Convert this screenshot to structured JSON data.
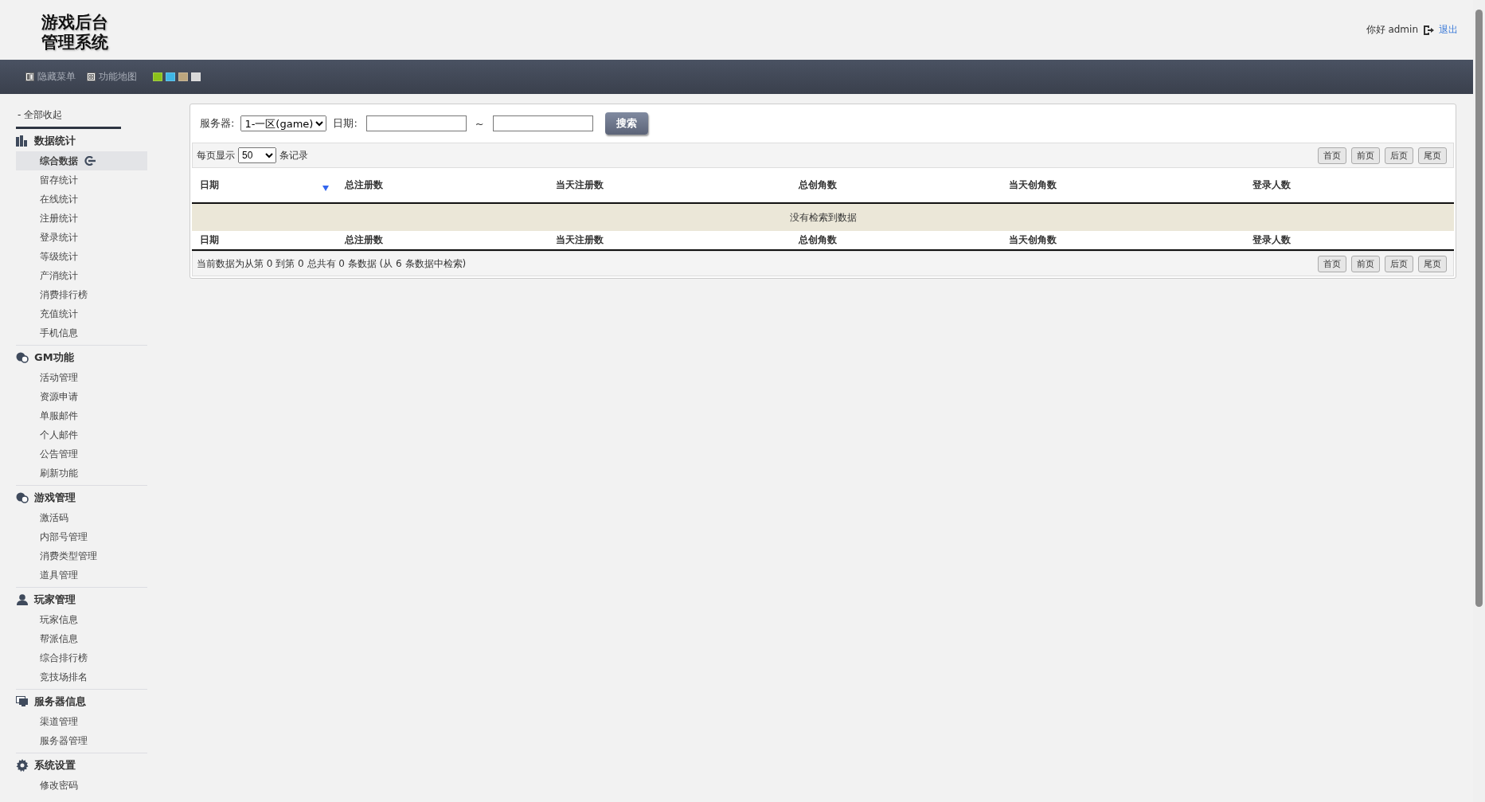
{
  "logo": {
    "lines": [
      "游戏后台",
      "管理系统"
    ]
  },
  "user": {
    "greeting": "你好 admin",
    "logout": "退出"
  },
  "toolbar": {
    "items": [
      {
        "label": "隐藏菜单",
        "kind": "columns"
      },
      {
        "label": "功能地图",
        "kind": "grid"
      }
    ],
    "theme_swatches": [
      {
        "color": "#8cc21a"
      },
      {
        "color": "#3eb6e6"
      },
      {
        "color": "#bca67e"
      },
      {
        "color": "#d8d8d8"
      }
    ]
  },
  "sidebar": {
    "collapse_all": "- 全部收起",
    "groups": [
      {
        "title": "数据统计",
        "items": [
          {
            "label": "综合数据",
            "selected": true
          },
          {
            "label": "留存统计",
            "selected": false
          },
          {
            "label": "在线统计",
            "selected": false
          },
          {
            "label": "注册统计",
            "selected": false
          },
          {
            "label": "登录统计",
            "selected": false
          },
          {
            "label": "等级统计",
            "selected": false
          },
          {
            "label": "产消统计",
            "selected": false
          },
          {
            "label": "消费排行榜",
            "selected": false
          },
          {
            "label": "充值统计",
            "selected": false
          },
          {
            "label": "手机信息",
            "selected": false
          }
        ]
      },
      {
        "title": "GM功能",
        "items": [
          {
            "label": "活动管理",
            "selected": false
          },
          {
            "label": "资源申请",
            "selected": false
          },
          {
            "label": "单服邮件",
            "selected": false
          },
          {
            "label": "个人邮件",
            "selected": false
          },
          {
            "label": "公告管理",
            "selected": false
          },
          {
            "label": "刷新功能",
            "selected": false
          }
        ]
      },
      {
        "title": "游戏管理",
        "items": [
          {
            "label": "激活码",
            "selected": false
          },
          {
            "label": "内部号管理",
            "selected": false
          },
          {
            "label": "消费类型管理",
            "selected": false
          },
          {
            "label": "道具管理",
            "selected": false
          }
        ]
      },
      {
        "title": "玩家管理",
        "items": [
          {
            "label": "玩家信息",
            "selected": false
          },
          {
            "label": "帮派信息",
            "selected": false
          },
          {
            "label": "综合排行榜",
            "selected": false
          },
          {
            "label": "竞技场排名",
            "selected": false
          }
        ]
      },
      {
        "title": "服务器信息",
        "items": [
          {
            "label": "渠道管理",
            "selected": false
          },
          {
            "label": "服务器管理",
            "selected": false
          }
        ]
      },
      {
        "title": "系统设置",
        "items": [
          {
            "label": "修改密码",
            "selected": false
          }
        ]
      }
    ]
  },
  "filter": {
    "server_label": "服务器:",
    "server_value": "1-一区(game)",
    "date_label": "日期:",
    "separator": "~",
    "search_button": "搜索"
  },
  "table": {
    "page_size_label": "每页显示",
    "page_size": "50",
    "page_size_suffix": "条记录",
    "pager": [
      "首页",
      "前页",
      "后页",
      "尾页"
    ],
    "columns": [
      {
        "label": "日期",
        "sorted": true
      },
      {
        "label": "总注册数",
        "sorted": false
      },
      {
        "label": "当天注册数",
        "sorted": false
      },
      {
        "label": "总创角数",
        "sorted": false
      },
      {
        "label": "当天创角数",
        "sorted": false
      },
      {
        "label": "登录人数",
        "sorted": false
      }
    ],
    "empty_message": "没有检索到数据",
    "footer_columns": [
      "日期",
      "总注册数",
      "当天注册数",
      "总创角数",
      "当天创角数",
      "登录人数"
    ],
    "pager_bottom": [
      "首页",
      "前页",
      "后页",
      "尾页"
    ],
    "info": "当前数据为从第 0 到第 0 总共有 0 条数据 (从 6 条数据中检索)"
  }
}
